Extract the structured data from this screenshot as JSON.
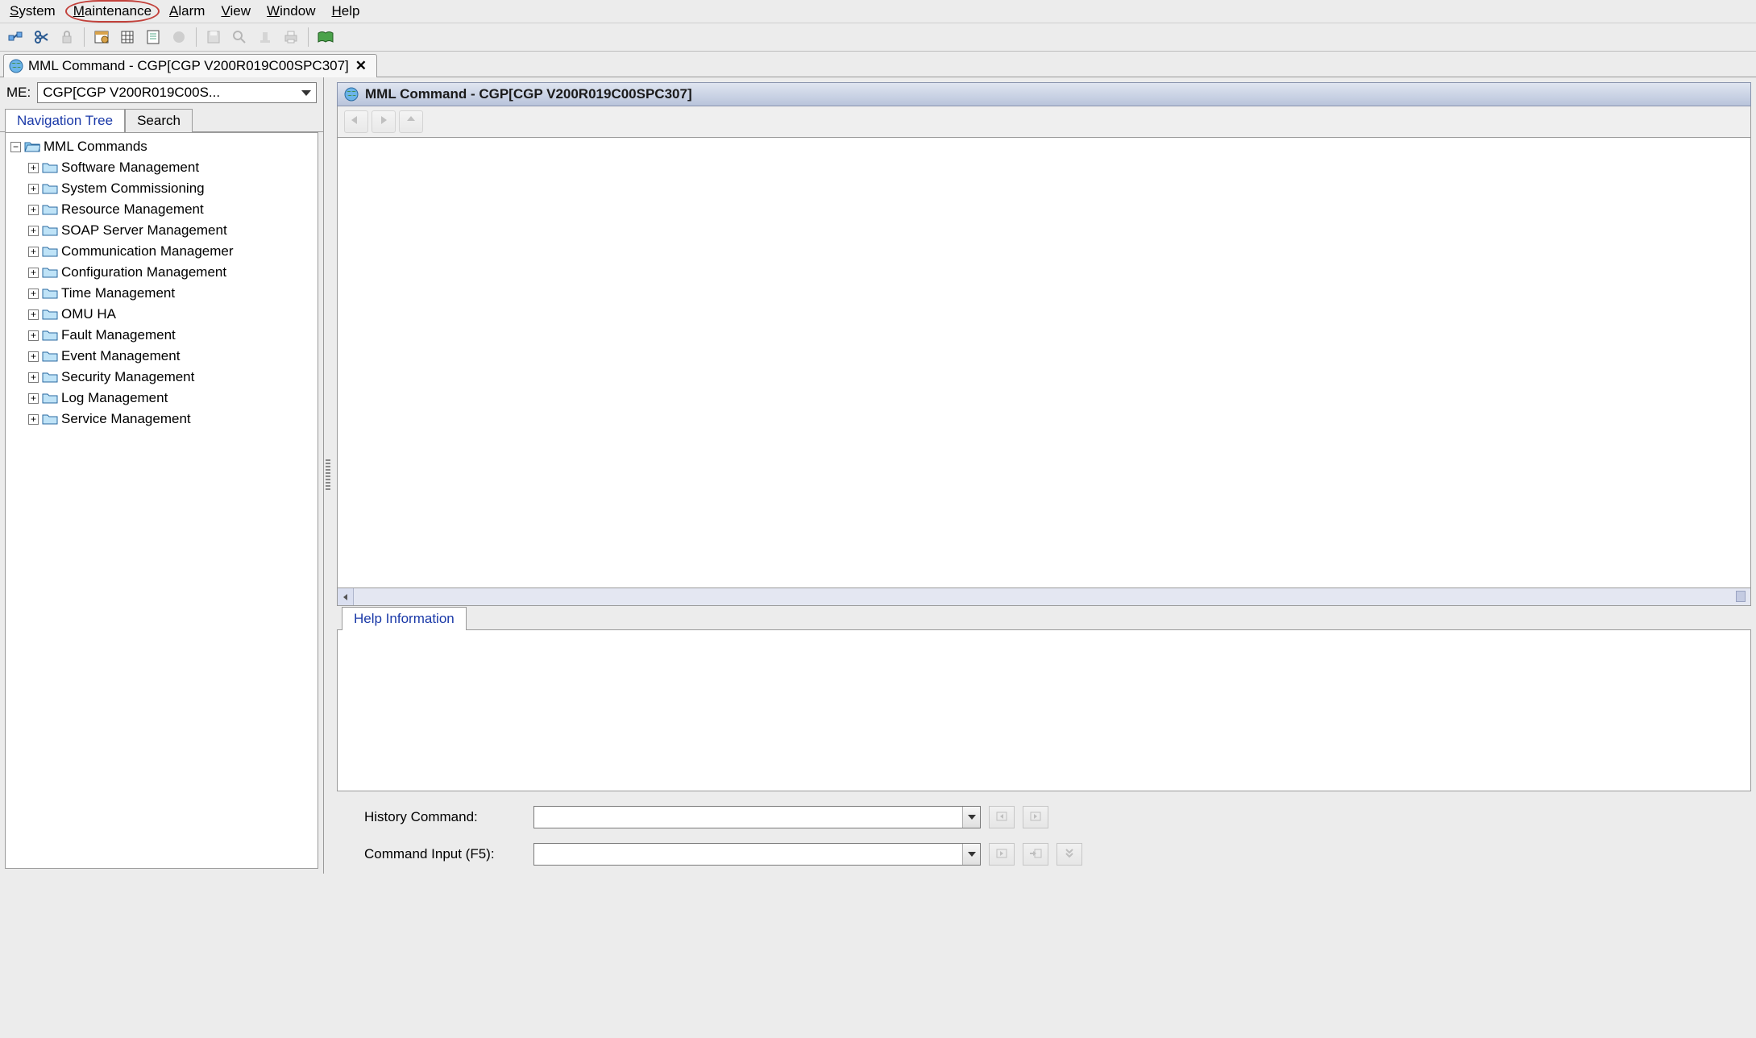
{
  "menu": {
    "system": "System",
    "maintenance": "Maintenance",
    "alarm": "Alarm",
    "view": "View",
    "window": "Window",
    "help": "Help"
  },
  "doc_tab": {
    "title": "MML Command - CGP[CGP V200R019C00SPC307]"
  },
  "left": {
    "me_label": "ME:",
    "me_value": "CGP[CGP V200R019C00S...",
    "tabs": {
      "navigation": "Navigation Tree",
      "search": "Search"
    },
    "tree_root": "MML Commands",
    "tree_children": [
      "Software Management",
      "System Commissioning",
      "Resource Management",
      "SOAP Server Management",
      "Communication Managemer",
      "Configuration Management",
      "Time Management",
      "OMU HA",
      "Fault Management",
      "Event Management",
      "Security Management",
      "Log Management",
      "Service Management"
    ]
  },
  "right": {
    "panel_title": "MML Command - CGP[CGP V200R019C00SPC307]",
    "help_tab": "Help Information",
    "history_label": "History Command:",
    "input_label": "Command Input (F5):"
  }
}
